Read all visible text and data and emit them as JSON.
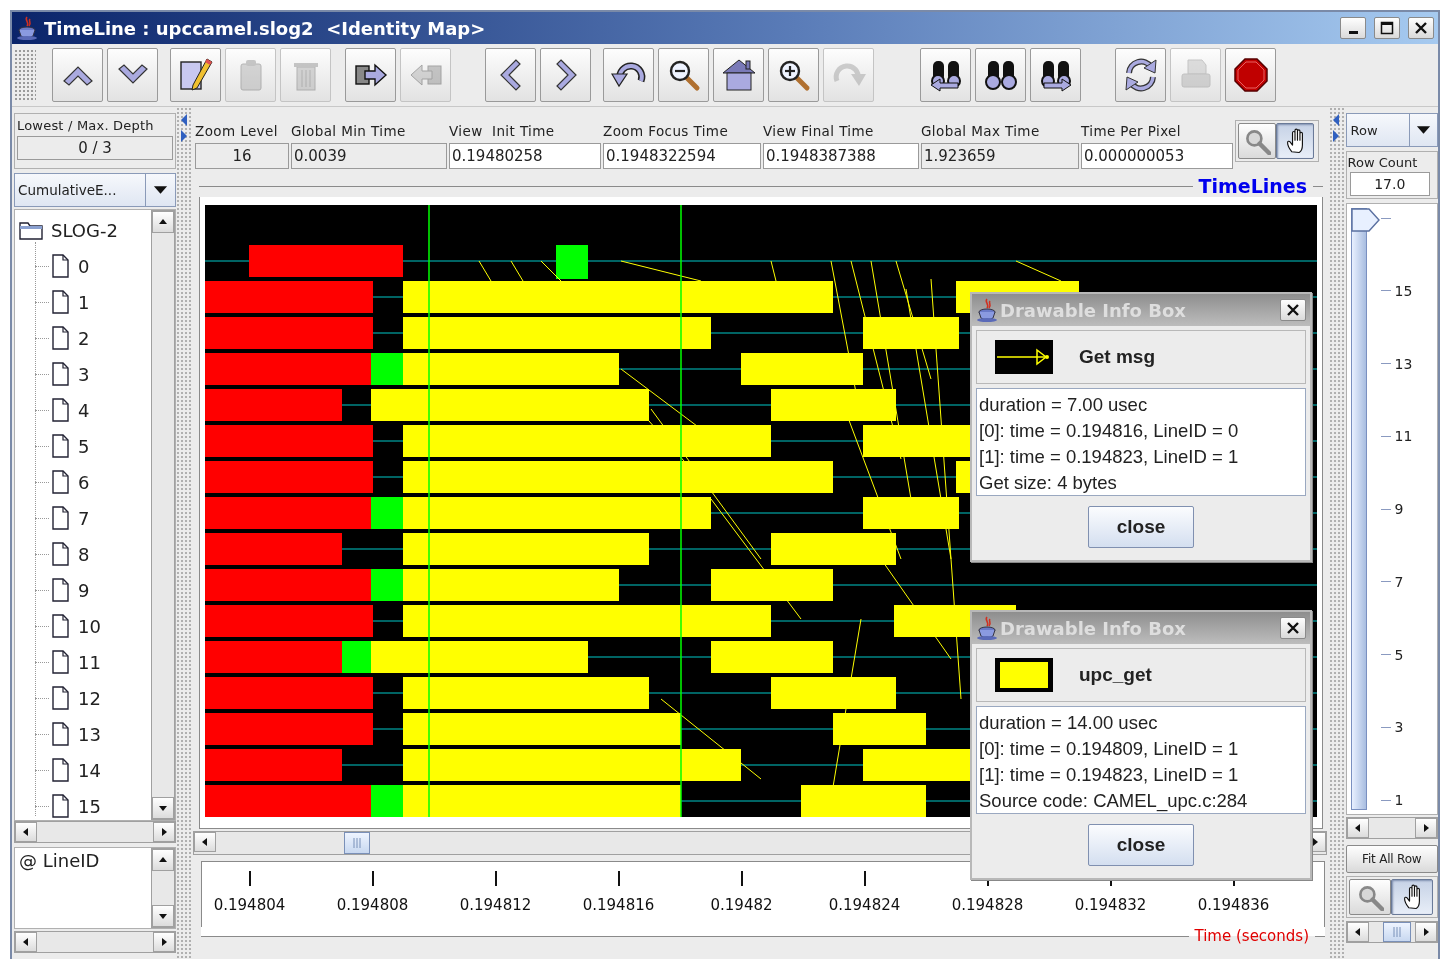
{
  "window": {
    "title": "TimeLine : upccamel.slog2  <Identity Map>"
  },
  "toolbar": [
    {
      "buttons": [
        {
          "kind": "up",
          "disabled": false
        },
        {
          "kind": "down",
          "disabled": false
        }
      ]
    },
    {
      "buttons": [
        {
          "kind": "edit",
          "disabled": false
        },
        {
          "kind": "clipboard",
          "disabled": true
        },
        {
          "kind": "trash",
          "disabled": true
        }
      ]
    },
    {
      "buttons": [
        {
          "kind": "export",
          "disabled": false
        },
        {
          "kind": "import",
          "disabled": true
        }
      ]
    },
    {
      "buttons": [
        {
          "kind": "prev",
          "disabled": false
        },
        {
          "kind": "next",
          "disabled": false
        }
      ]
    },
    {
      "buttons": [
        {
          "kind": "undo",
          "disabled": false
        },
        {
          "kind": "zoom-out",
          "disabled": false
        },
        {
          "kind": "home",
          "disabled": false
        },
        {
          "kind": "zoom-in",
          "disabled": false
        },
        {
          "kind": "redo",
          "disabled": true
        }
      ]
    },
    {
      "buttons": [
        {
          "kind": "search-back",
          "disabled": false
        },
        {
          "kind": "search",
          "disabled": false
        },
        {
          "kind": "search-forward",
          "disabled": false
        }
      ]
    },
    {
      "buttons": [
        {
          "kind": "refresh",
          "disabled": false
        },
        {
          "kind": "print",
          "disabled": true
        },
        {
          "kind": "stop",
          "disabled": false
        }
      ]
    }
  ],
  "left_panel": {
    "depth_label": "Lowest / Max. Depth",
    "depth_value": "0 / 3",
    "view_select": "CumulativeE...",
    "tree": {
      "label": "SLOG-2",
      "children": [
        {
          "label": "0"
        },
        {
          "label": "1"
        },
        {
          "label": "2"
        },
        {
          "label": "3"
        },
        {
          "label": "4"
        },
        {
          "label": "5"
        },
        {
          "label": "6"
        },
        {
          "label": "7"
        },
        {
          "label": "8"
        },
        {
          "label": "9"
        },
        {
          "label": "10"
        },
        {
          "label": "11"
        },
        {
          "label": "12"
        },
        {
          "label": "13"
        },
        {
          "label": "14"
        },
        {
          "label": "15"
        }
      ]
    },
    "list": [
      {
        "label": "@ LineID"
      }
    ]
  },
  "fields": [
    {
      "label": "Zoom Level",
      "value": "16",
      "editable": false
    },
    {
      "label": "Global Min Time",
      "value": "0.0039",
      "editable": false
    },
    {
      "label": "View  Init Time",
      "value": "0.19480258",
      "editable": true
    },
    {
      "label": "Zoom Focus Time",
      "value": "0.1948322594",
      "editable": true
    },
    {
      "label": "View Final Time",
      "value": "0.1948387388",
      "editable": true
    },
    {
      "label": "Global Max Time",
      "value": "1.923659",
      "editable": false
    },
    {
      "label": "Time Per Pixel",
      "value": "0.000000053",
      "editable": true
    }
  ],
  "pointer_modes": [
    {
      "kind": "zoom",
      "selected": false
    },
    {
      "kind": "hand",
      "selected": true
    }
  ],
  "timelines": {
    "title": "TimeLines"
  },
  "time_axis": {
    "ticks": [
      "0.194804",
      "0.194808",
      "0.194812",
      "0.194816",
      "0.19482",
      "0.194824",
      "0.194828",
      "0.194832",
      "0.194836"
    ],
    "title": "Time (seconds)"
  },
  "right_panel": {
    "row_select": "Row",
    "row_count_label": "Row Count",
    "row_count": "17.0",
    "row_slider": {
      "level": 1,
      "labels": [
        "15",
        "13",
        "11",
        "9",
        "7",
        "5",
        "3",
        "1"
      ]
    },
    "fit_button": "Fit All Row",
    "pointer_modes": [
      {
        "kind": "zoom",
        "selected": false
      },
      {
        "kind": "hand",
        "selected": true
      }
    ]
  },
  "info_boxes": [
    {
      "title": "Drawable Info Box",
      "kind": "arrow",
      "name": "Get msg",
      "lines": [
        "duration = 7.00 usec",
        "[0]: time = 0.194816, LineID = 0",
        "[1]: time = 0.194823, LineID = 1",
        "Get size: 4 bytes"
      ],
      "close": "close"
    },
    {
      "title": "Drawable Info Box",
      "kind": "state",
      "name": "upc_get",
      "lines": [
        "duration = 14.00 usec",
        "[0]: time = 0.194809, LineID = 1",
        "[1]: time = 0.194823, LineID = 1",
        "Source code: CAMEL_upc.c:284"
      ],
      "close": "close"
    }
  ]
}
